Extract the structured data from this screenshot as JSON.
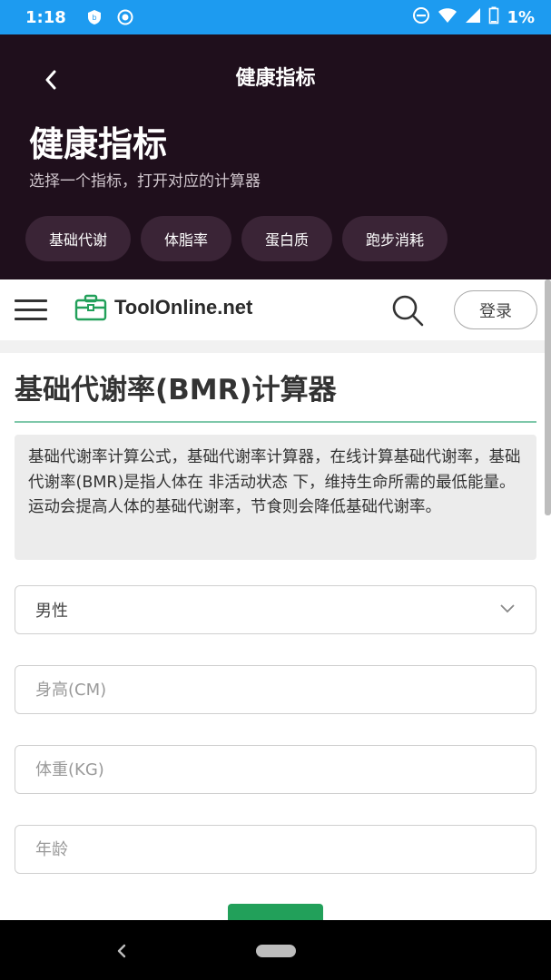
{
  "status_bar": {
    "time": "1:18",
    "battery": "1%",
    "icons": [
      "shield-icon",
      "sync-icon",
      "dnd-icon",
      "wifi-icon",
      "signal-icon",
      "battery-icon"
    ]
  },
  "app_header": {
    "nav_title": "健康指标",
    "title": "健康指标",
    "subtitle": "选择一个指标，打开对应的计算器",
    "chips": [
      "基础代谢",
      "体脂率",
      "蛋白质",
      "跑步消耗"
    ]
  },
  "site": {
    "brand": "ToolOnline.net",
    "login": "登录"
  },
  "page": {
    "heading": "基础代谢率(BMR)计算器",
    "description": "基础代谢率计算公式，基础代谢率计算器，在线计算基础代谢率，基础代谢率(BMR)是指人体在 非活动状态 下，维持生命所需的最低能量。运动会提高人体的基础代谢率，节食则会降低基础代谢率。"
  },
  "form": {
    "gender_value": "男性",
    "height_placeholder": "身高(CM)",
    "weight_placeholder": "体重(KG)",
    "age_placeholder": "年龄"
  },
  "colors": {
    "status_bar": "#1d9bf0",
    "header_bg": "#1f0f1c",
    "chip_bg": "#3a2436",
    "brand_green": "#22a05a",
    "underline": "#7fc8aa"
  }
}
